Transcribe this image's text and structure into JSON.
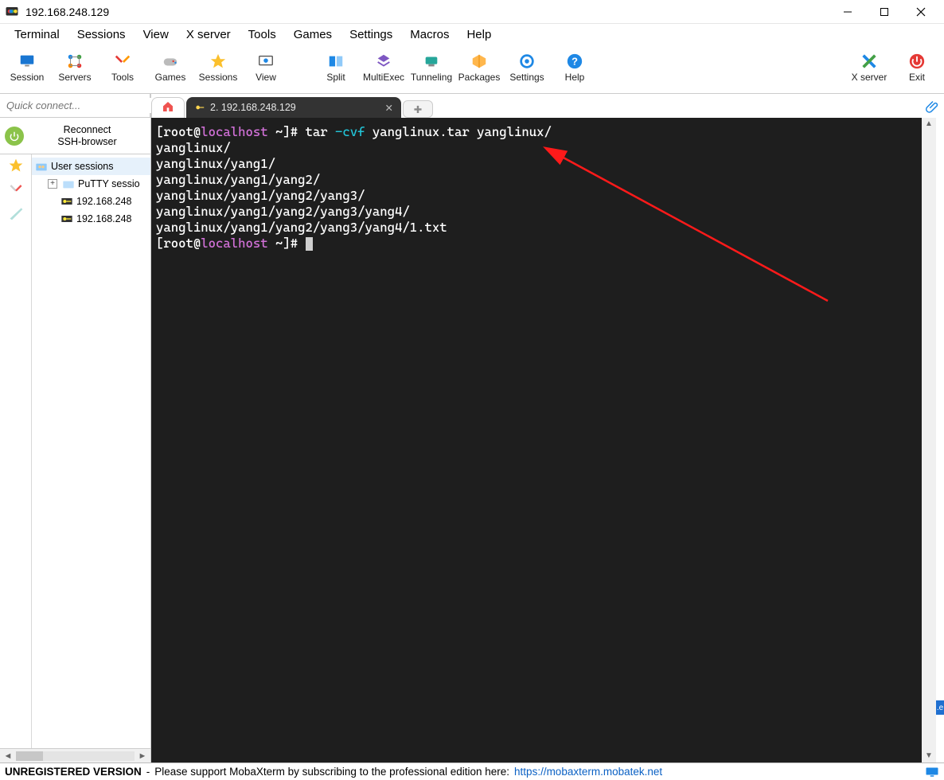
{
  "window": {
    "title": "192.168.248.129"
  },
  "menu": {
    "items": [
      "Terminal",
      "Sessions",
      "View",
      "X server",
      "Tools",
      "Games",
      "Settings",
      "Macros",
      "Help"
    ]
  },
  "toolbar": {
    "left": [
      {
        "name": "session",
        "label": "Session"
      },
      {
        "name": "servers",
        "label": "Servers"
      },
      {
        "name": "tools",
        "label": "Tools"
      },
      {
        "name": "games",
        "label": "Games"
      },
      {
        "name": "sessions",
        "label": "Sessions"
      },
      {
        "name": "view",
        "label": "View"
      },
      {
        "name": "split",
        "label": "Split"
      },
      {
        "name": "multiexec",
        "label": "MultiExec"
      },
      {
        "name": "tunneling",
        "label": "Tunneling"
      },
      {
        "name": "packages",
        "label": "Packages"
      },
      {
        "name": "settings",
        "label": "Settings"
      },
      {
        "name": "help",
        "label": "Help"
      }
    ],
    "right": [
      {
        "name": "xserver",
        "label": "X server"
      },
      {
        "name": "exit",
        "label": "Exit"
      }
    ]
  },
  "sidebar": {
    "quick_connect_placeholder": "Quick connect...",
    "reconnect_line1": "Reconnect",
    "reconnect_line2": "SSH-browser",
    "tree": {
      "root_label": "User sessions",
      "items": [
        {
          "label": "PuTTY sessio"
        },
        {
          "label": "192.168.248"
        },
        {
          "label": "192.168.248"
        }
      ]
    }
  },
  "tabs": {
    "active_label": "2. 192.168.248.129",
    "add_label": "+"
  },
  "terminal": {
    "prompt_user": "root",
    "prompt_host": "localhost",
    "prompt_dir": "~",
    "command_text": "tar",
    "command_opt": "-cvf",
    "command_args": "yanglinux.tar yanglinux/",
    "output_lines": [
      "yanglinux/",
      "yanglinux/yang1/",
      "yanglinux/yang1/yang2/",
      "yanglinux/yang1/yang2/yang3/",
      "yanglinux/yang1/yang2/yang3/yang4/",
      "yanglinux/yang1/yang2/yang3/yang4/1.txt"
    ]
  },
  "statusbar": {
    "unreg": "UNREGISTERED VERSION",
    "dash": "  -  ",
    "msg": "Please support MobaXterm by subscribing to the professional edition here:  ",
    "link": "https://mobaxterm.mobatek.net"
  }
}
